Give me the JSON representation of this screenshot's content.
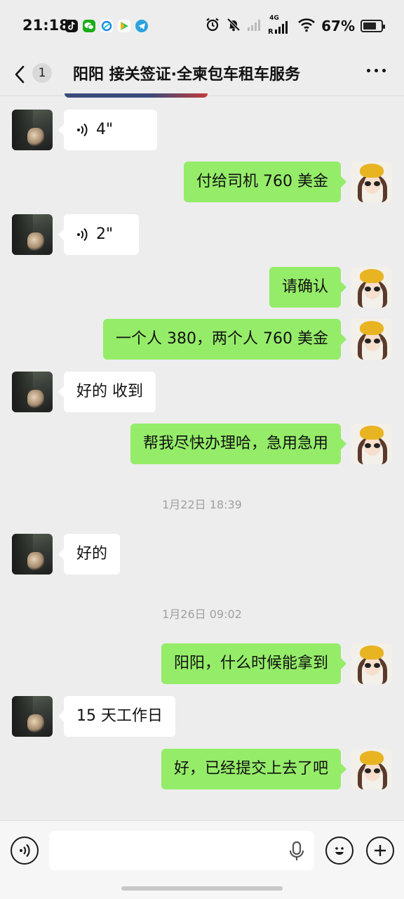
{
  "status_bar": {
    "time": "21:18",
    "battery": "67%",
    "network_label": "4G",
    "apps": [
      "tiktok-icon",
      "wechat-icon",
      "qq-browser-icon",
      "video-app-icon",
      "telegram-icon"
    ]
  },
  "header": {
    "unread_count": "1",
    "title": "阳阳 接关签证·全柬包车租车服务"
  },
  "messages": [
    {
      "side": "left",
      "kind": "voice",
      "text": "4\""
    },
    {
      "side": "right",
      "kind": "text",
      "text": "付给司机 760 美金"
    },
    {
      "side": "left",
      "kind": "voice",
      "text": "2\""
    },
    {
      "side": "right",
      "kind": "text",
      "text": "请确认"
    },
    {
      "side": "right",
      "kind": "text",
      "text": "一个人 380，两个人 760 美金"
    },
    {
      "side": "left",
      "kind": "text",
      "text": "好的 收到"
    },
    {
      "side": "right",
      "kind": "text",
      "text": "帮我尽快办理哈，急用急用"
    },
    {
      "side": "system",
      "kind": "timestamp",
      "text": "1月22日 18:39"
    },
    {
      "side": "left",
      "kind": "text",
      "text": "好的"
    },
    {
      "side": "system",
      "kind": "timestamp",
      "text": "1月26日 09:02"
    },
    {
      "side": "right",
      "kind": "text",
      "text": "阳阳，什么时候能拿到"
    },
    {
      "side": "left",
      "kind": "text",
      "text": "15 天工作日"
    },
    {
      "side": "right",
      "kind": "text",
      "text": "好，已经提交上去了吧"
    }
  ],
  "input": {
    "value": "",
    "placeholder": ""
  },
  "colors": {
    "background": "#ededed",
    "bubble_sent": "#95ec69",
    "bubble_received": "#ffffff",
    "timestamp_text": "#a0a0a0"
  }
}
